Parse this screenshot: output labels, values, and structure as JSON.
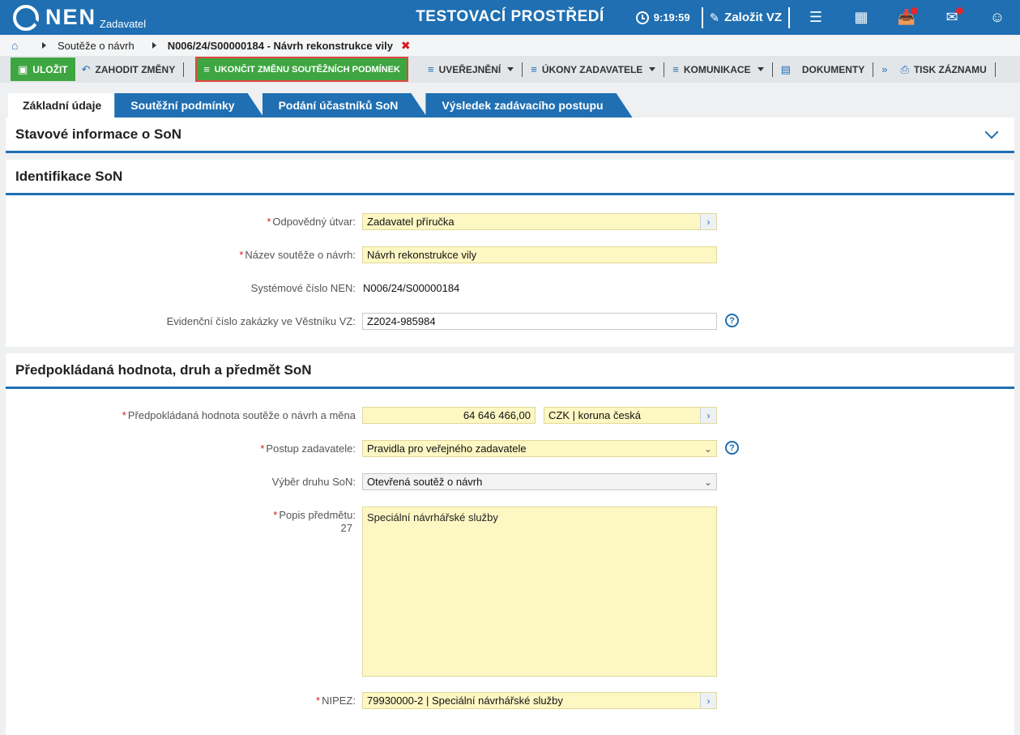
{
  "header": {
    "logo": "NEN",
    "logo_sub": "Zadavatel",
    "env_title": "TESTOVACÍ PROSTŘEDÍ",
    "time": "9:19:59",
    "create_label": "Založit VZ",
    "icons": [
      "menu-icon",
      "calculator-icon",
      "inbox-icon",
      "mail-icon",
      "user-icon"
    ]
  },
  "breadcrumb": {
    "item1": "Soutěže o návrh",
    "current": "N006/24/S00000184 - Návrh rekonstrukce vily"
  },
  "toolbar": {
    "save": "ULOŽIT",
    "discard": "ZAHODIT ZMĚNY",
    "end_change": "UKONČIT ZMĚNU SOUTĚŽNÍCH PODMÍNEK",
    "publish": "UVEŘEJNĚNÍ",
    "actions": "ÚKONY ZADAVATELE",
    "communication": "KOMUNIKACE",
    "documents": "DOKUMENTY",
    "print": "TISK ZÁZNAMU"
  },
  "tabs": [
    "Základní údaje",
    "Soutěžní podmínky",
    "Podání účastníků SoN",
    "Výsledek zadávacího postupu"
  ],
  "sections": {
    "status": "Stavové informace o SoN",
    "ident": "Identifikace SoN",
    "value": "Předpokládaná hodnota, druh a předmět SoN"
  },
  "ident": {
    "unit_label": "Odpovědný útvar:",
    "unit_value": "Zadavatel příručka",
    "name_label": "Název soutěže o návrh:",
    "name_value": "Návrh rekonstrukce vily",
    "sys_label": "Systémové číslo NEN:",
    "sys_value": "N006/24/S00000184",
    "evid_label": "Evidenční číslo zakázky ve Věstníku VZ:",
    "evid_value": "Z2024-985984"
  },
  "value": {
    "amount_label": "Předpokládaná hodnota soutěže o návrh a měna",
    "amount_value": "64 646 466,00",
    "currency_value": "CZK | koruna česká",
    "procedure_label": "Postup zadavatele:",
    "procedure_value": "Pravidla pro veřejného zadavatele",
    "kind_label": "Výběr druhu SoN:",
    "kind_value": "Otevřená soutěž o návrh",
    "desc_label": "Popis předmětu:",
    "desc_count": "27",
    "desc_value": "Speciální návrhářské služby",
    "nipez_label": "NIPEZ:",
    "nipez_value": "79930000-2 | Speciální návrhářské služby"
  }
}
